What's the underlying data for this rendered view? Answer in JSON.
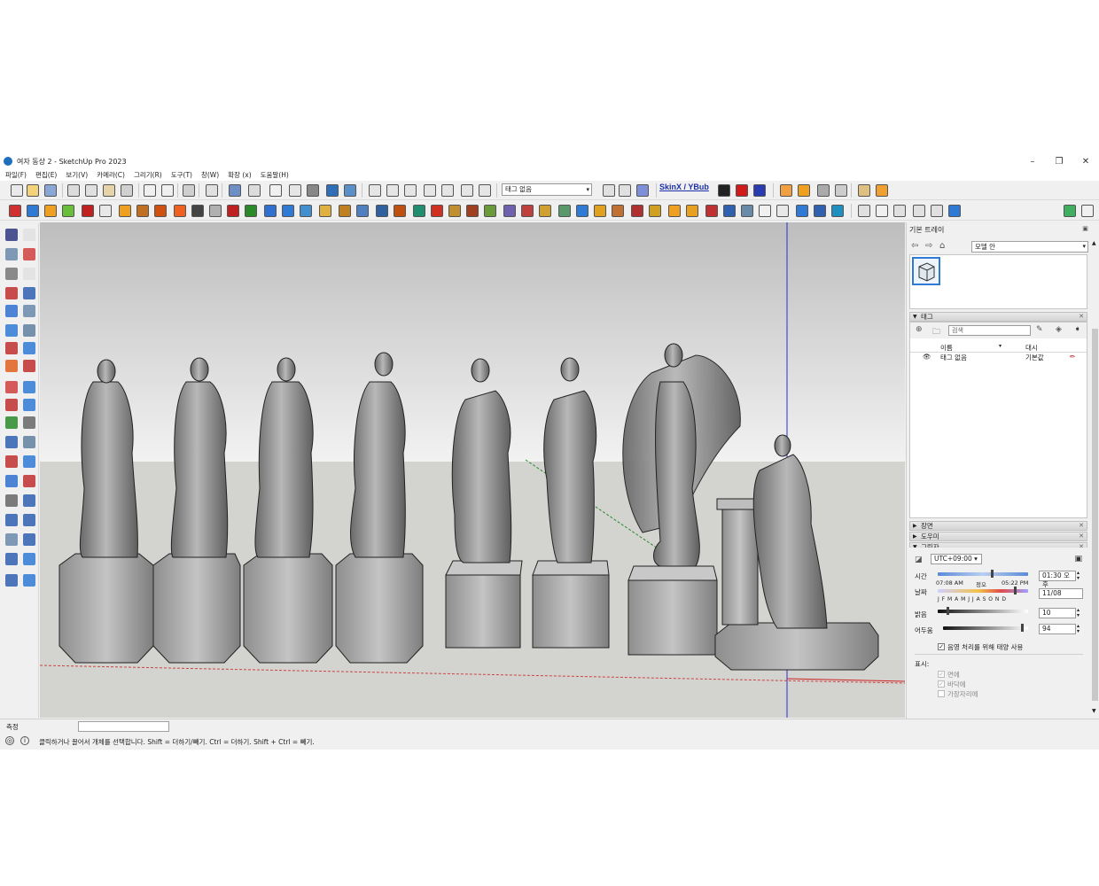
{
  "window": {
    "title": "여자 동상 2 - SketchUp Pro 2023",
    "controls": [
      "–",
      "❐",
      "✕"
    ]
  },
  "menu": [
    "파일(F)",
    "편집(E)",
    "보기(V)",
    "카메라(C)",
    "그리기(R)",
    "도구(T)",
    "창(W)",
    "확장 (x)",
    "도움말(H)"
  ],
  "toolbar": {
    "tag_dropdown": "태그 없음",
    "skinx_label": "SkinX / YBub"
  },
  "colors": {
    "accent_blue": "#2f7ad4",
    "sky_top": "#b8b8b8",
    "sky_bottom": "#f0f0f0",
    "ground": "#d4d4d0",
    "axis_blue": "#2d2dcc",
    "axis_red": "#cc2222",
    "axis_green": "#2a8a2a"
  },
  "measure": {
    "label": "측정",
    "value": ""
  },
  "status": {
    "message": "클릭하거나 끌어서 개체를 선택합니다. Shift = 더하기/빼기. Ctrl = 더하기. Shift + Ctrl = 빼기."
  },
  "tray": {
    "title": "기본 트레이",
    "model_dropdown": "모델 안",
    "sections": {
      "tags": "태그",
      "scenes": "장면",
      "styles": "도우미",
      "shadows": "그림자"
    },
    "tags": {
      "search_placeholder": "검색",
      "col_name": "이름",
      "col_dash": "대시",
      "row_name": "태그 없음",
      "row_dash": "기본값"
    },
    "shadows": {
      "timezone": "UTC+09:00",
      "time_label": "시간",
      "time_start": "07:08 AM",
      "time_noon": "정오",
      "time_end": "05:22 PM",
      "time_value": "01:30 오후",
      "date_label": "날짜",
      "months": "J F M A M J J A S O N D",
      "date_value": "11/08",
      "light_label": "밝음",
      "light_value": "10",
      "dark_label": "어두움",
      "dark_value": "94",
      "sun_option": "음영 처리를 위해 태양 사용",
      "display_label": "표시:",
      "display_faces": "면에",
      "display_ground": "바닥에",
      "display_edges": "가장자리에"
    }
  }
}
